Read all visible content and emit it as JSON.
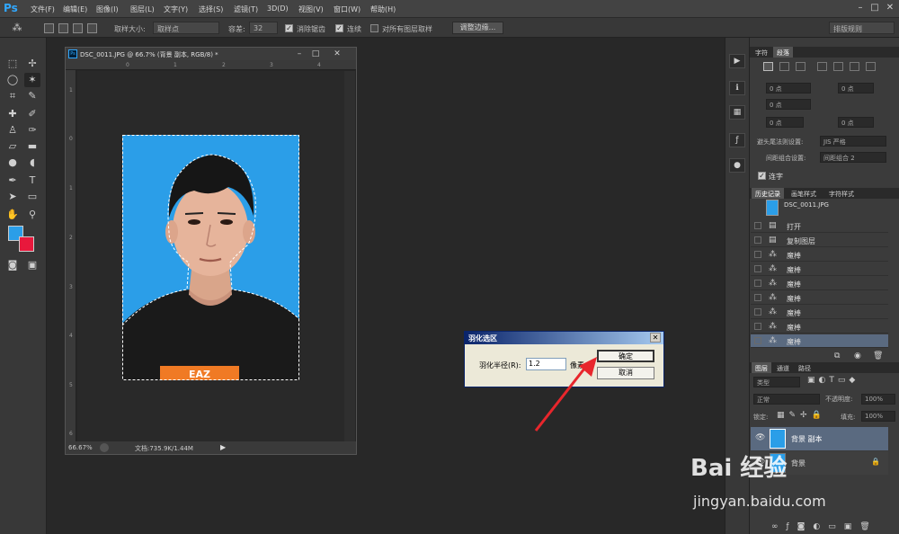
{
  "app": {
    "logo": "Ps"
  },
  "menu": [
    "文件(F)",
    "编辑(E)",
    "图像(I)",
    "图层(L)",
    "文字(Y)",
    "选择(S)",
    "滤镜(T)",
    "3D(D)",
    "视图(V)",
    "窗口(W)",
    "帮助(H)"
  ],
  "options": {
    "sample_size_label": "取样大小:",
    "sample_size_value": "取样点",
    "tolerance_label": "容差:",
    "tolerance_value": "32",
    "antialias_label": "消除锯齿",
    "contiguous_label": "连续",
    "all_layers_label": "对所有图层取样",
    "refine_edge_label": "调整边缘...",
    "workspace": "排版规则"
  },
  "document": {
    "title": "DSC_0011.JPG @ 66.7% (背景 副本, RGB/8) *",
    "zoom": "66.67%",
    "doc_size": "文档:735.9K/1.44M",
    "ruler_h": [
      "0",
      "1",
      "2",
      "3",
      "4"
    ],
    "ruler_v": [
      "1",
      "0",
      "1",
      "2",
      "3",
      "4",
      "5",
      "6"
    ]
  },
  "dialog": {
    "title": "羽化选区",
    "radius_label": "羽化半径(R):",
    "radius_value": "1.2",
    "unit": "像素",
    "ok_label": "确定",
    "cancel_label": "取消"
  },
  "char_panel": {
    "tabs": [
      "字符",
      "段落"
    ],
    "fields": [
      "0 点",
      "0 点",
      "0 点",
      "0 点",
      "0 点"
    ],
    "hanging_label": "避头尾法则设置:",
    "hanging_value": "JIS 严格",
    "spacing_label": "间距组合设置:",
    "spacing_value": "间距组合 2",
    "hyphen_label": "连字"
  },
  "history_panel": {
    "tabs": [
      "历史记录",
      "画笔样式",
      "字符样式"
    ],
    "snapshot": "DSC_0011.JPG",
    "items": [
      "打开",
      "复制图层",
      "魔棒",
      "魔棒",
      "魔棒",
      "魔棒",
      "魔棒",
      "魔棒",
      "魔棒"
    ]
  },
  "layers_panel": {
    "tabs": [
      "图层",
      "通道",
      "路径"
    ],
    "kind": "类型",
    "blend": "正常",
    "opacity_label": "不透明度:",
    "opacity_value": "100%",
    "lock_label": "锁定:",
    "fill_label": "填充:",
    "fill_value": "100%",
    "layers": [
      "背景 副本",
      "背景"
    ]
  },
  "watermark": {
    "brand": "Bai 经验",
    "url": "jingyan.baidu.com"
  },
  "colors": {
    "foreground": "#2b9ee8",
    "background": "#e8183c",
    "accent": "#31a8ff"
  }
}
